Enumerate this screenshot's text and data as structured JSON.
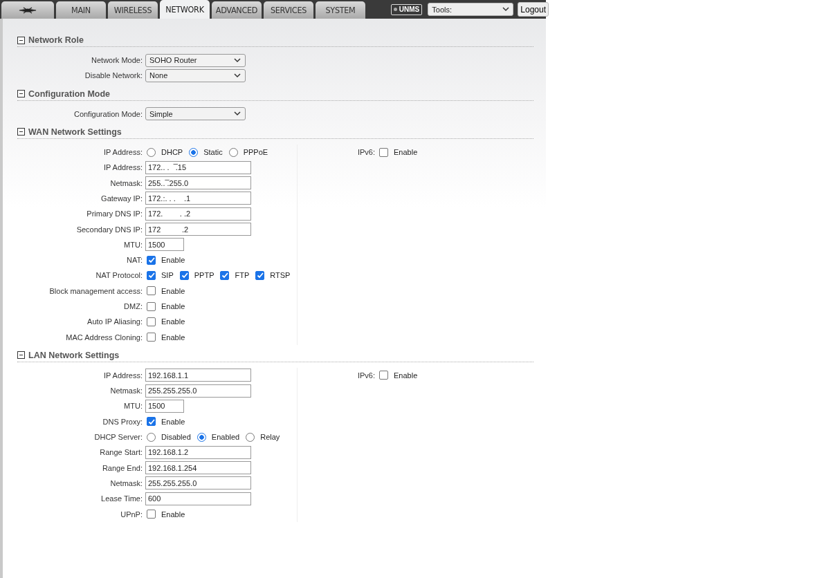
{
  "header": {
    "tabs": [
      {
        "label": "MAIN",
        "selected": false
      },
      {
        "label": "WIRELESS",
        "selected": false
      },
      {
        "label": "NETWORK",
        "selected": true
      },
      {
        "label": "ADVANCED",
        "selected": false
      },
      {
        "label": "SERVICES",
        "selected": false
      },
      {
        "label": "SYSTEM",
        "selected": false
      }
    ],
    "badge": "UNMS",
    "tools": "Tools:",
    "logout": "Logout"
  },
  "sections": [
    {
      "title": "Network Role",
      "expanded": true,
      "rows": [
        {
          "kind": "select",
          "label": "Network Mode:",
          "value": "SOHO Router"
        },
        {
          "kind": "select",
          "label": "Disable Network:",
          "value": "None"
        }
      ]
    },
    {
      "title": "Configuration Mode",
      "expanded": true,
      "rows": [
        {
          "kind": "select",
          "label": "Configuration Mode:",
          "value": "Simple"
        }
      ]
    },
    {
      "title": "WAN Network Settings",
      "expanded": true,
      "rows": [
        {
          "kind": "radio",
          "label": "IP Address:",
          "options": [
            {
              "label": "DHCP",
              "selected": false
            },
            {
              "label": "Static",
              "selected": true
            },
            {
              "label": "PPPoE",
              "selected": false
            }
          ]
        },
        {
          "kind": "text",
          "label": "IP Address:",
          "value": "172.. .   ̅.15"
        },
        {
          "kind": "text",
          "label": "Netmask:",
          "value": "255.. ̅.255.0"
        },
        {
          "kind": "text",
          "label": "Gateway IP:",
          "value": "172.:. . .    .1"
        },
        {
          "kind": "text",
          "label": "Primary DNS IP:",
          "value": "172.        . .2"
        },
        {
          "kind": "text",
          "label": "Secondary DNS IP:",
          "value": "172          .2"
        },
        {
          "kind": "short",
          "label": "MTU:",
          "value": "1500"
        },
        {
          "kind": "checks",
          "label": "NAT:",
          "options": [
            {
              "label": "Enable",
              "checked": true
            }
          ]
        },
        {
          "kind": "checks",
          "label": "NAT Protocol:",
          "options": [
            {
              "label": "SIP",
              "checked": true
            },
            {
              "label": "PPTP",
              "checked": true
            },
            {
              "label": "FTP",
              "checked": true
            },
            {
              "label": "RTSP",
              "checked": true
            }
          ]
        },
        {
          "kind": "checks",
          "label": "Block management access:",
          "options": [
            {
              "label": "Enable",
              "checked": false
            }
          ]
        },
        {
          "kind": "checks",
          "label": "DMZ:",
          "options": [
            {
              "label": "Enable",
              "checked": false
            }
          ]
        },
        {
          "kind": "checks",
          "label": "Auto IP Aliasing:",
          "options": [
            {
              "label": "Enable",
              "checked": false
            }
          ]
        },
        {
          "kind": "checks",
          "label": "MAC Address Cloning:",
          "options": [
            {
              "label": "Enable",
              "checked": false
            }
          ]
        }
      ],
      "side": [
        {
          "kind": "checks",
          "label": "IPv6:",
          "options": [
            {
              "label": "Enable",
              "checked": false
            }
          ]
        }
      ]
    },
    {
      "title": "LAN Network Settings",
      "expanded": true,
      "rows": [
        {
          "kind": "text",
          "label": "IP Address:",
          "value": "192.168.1.1"
        },
        {
          "kind": "text",
          "label": "Netmask:",
          "value": "255.255.255.0"
        },
        {
          "kind": "short",
          "label": "MTU:",
          "value": "1500"
        },
        {
          "kind": "checks",
          "label": "DNS Proxy:",
          "options": [
            {
              "label": "Enable",
              "checked": true
            }
          ]
        },
        {
          "kind": "radio",
          "label": "DHCP Server:",
          "options": [
            {
              "label": "Disabled",
              "selected": false
            },
            {
              "label": "Enabled",
              "selected": true
            },
            {
              "label": "Relay",
              "selected": false
            }
          ]
        },
        {
          "kind": "text",
          "label": "Range Start:",
          "value": "192.168.1.2"
        },
        {
          "kind": "text",
          "label": "Range End:",
          "value": "192.168.1.254"
        },
        {
          "kind": "text",
          "label": "Netmask:",
          "value": "255.255.255.0"
        },
        {
          "kind": "text",
          "label": "Lease Time:",
          "value": "600"
        },
        {
          "kind": "checks",
          "label": "UPnP:",
          "options": [
            {
              "label": "Enable",
              "checked": false
            }
          ]
        }
      ],
      "side": [
        {
          "kind": "checks",
          "label": "IPv6:",
          "options": [
            {
              "label": "Enable",
              "checked": false
            }
          ]
        }
      ]
    }
  ]
}
